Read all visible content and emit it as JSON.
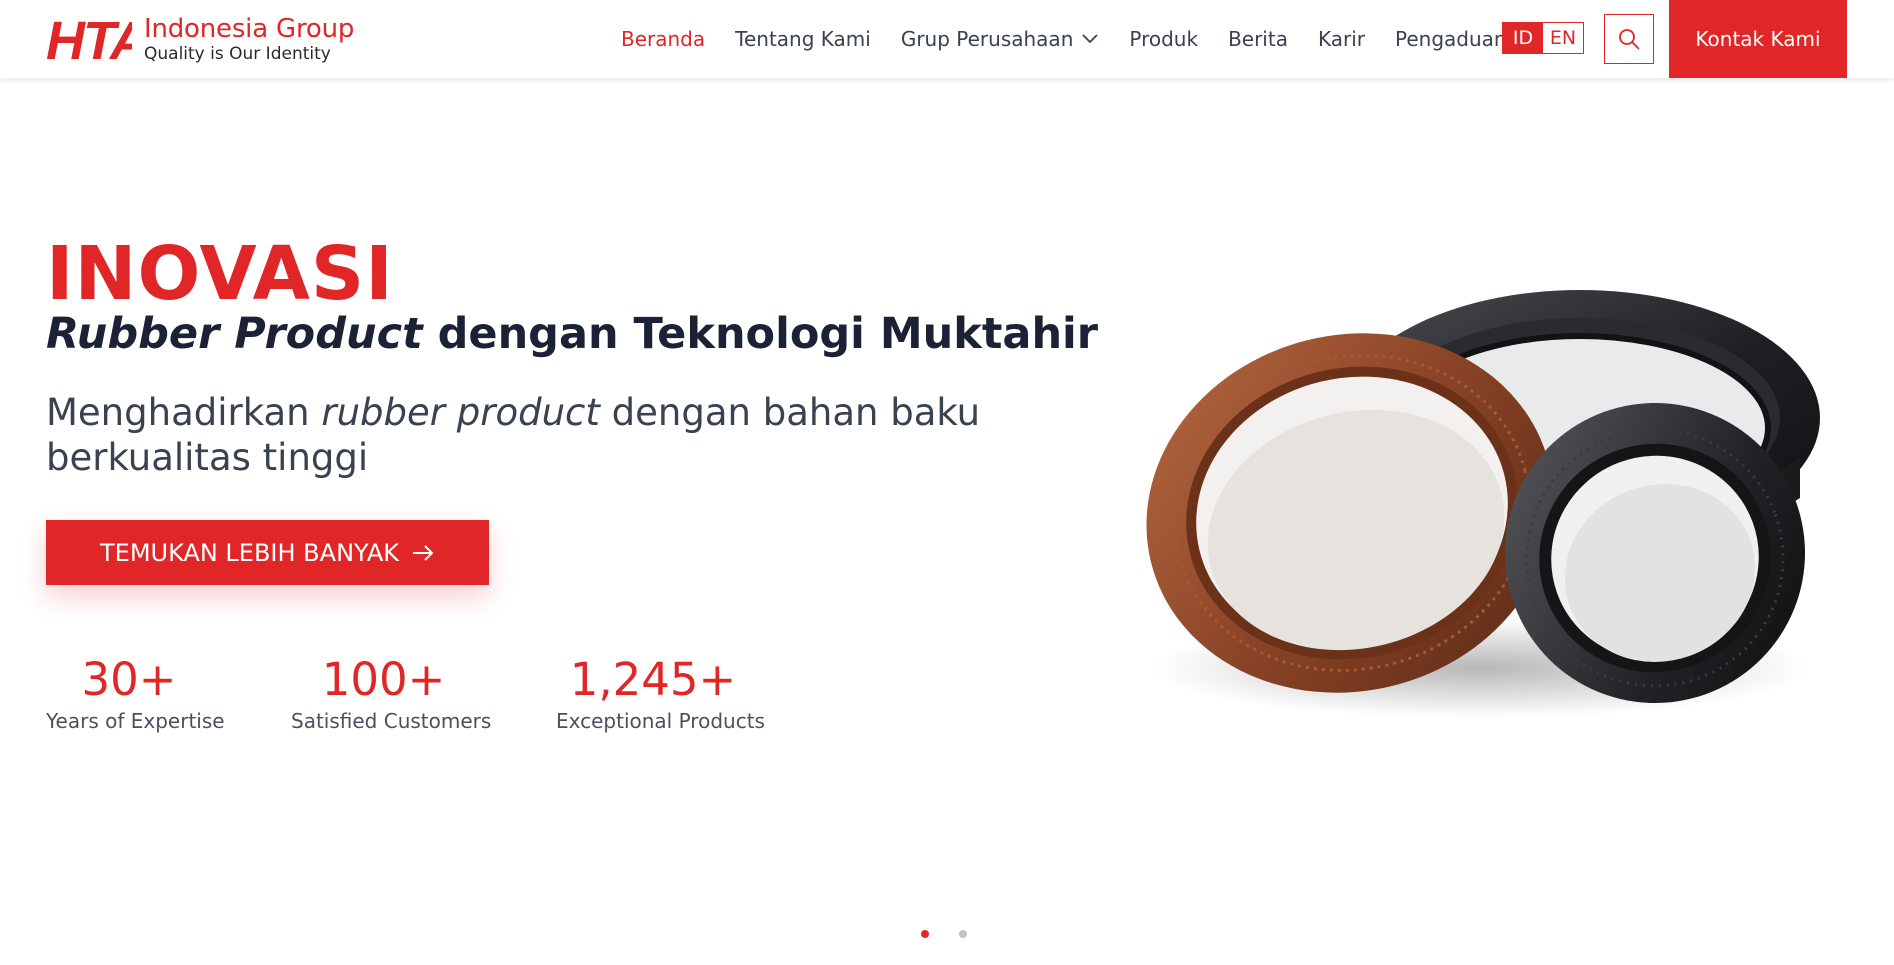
{
  "brand": {
    "mark": "HTA",
    "name": "Indonesia Group",
    "tagline": "Quality is Our Identity",
    "color": "#e12627"
  },
  "nav": {
    "items": [
      {
        "label": "Beranda",
        "active": true
      },
      {
        "label": "Tentang Kami"
      },
      {
        "label": "Grup Perusahaan",
        "icon": "chevron-down-icon"
      },
      {
        "label": "Produk"
      },
      {
        "label": "Berita"
      },
      {
        "label": "Karir"
      },
      {
        "label": "Pengaduan"
      }
    ]
  },
  "language": {
    "options": [
      "ID",
      "EN"
    ],
    "selected": "ID"
  },
  "search": {
    "icon": "search-icon"
  },
  "contact": {
    "label": "Kontak Kami"
  },
  "hero": {
    "title": "INOVASI",
    "subtitle_italic": "Rubber Product",
    "subtitle_rest": " dengan Teknologi Muktahir",
    "desc_part1": "Menghadirkan ",
    "desc_italic": "rubber product",
    "desc_part2": " dengan bahan baku berkualitas tinggi",
    "cta_label": "TEMUKAN LEBIH BANYAK",
    "cta_icon": "arrow-right-icon",
    "image": "oil-seal-rings-image"
  },
  "stats": [
    {
      "value": "30+",
      "label": "Years of Expertise"
    },
    {
      "value": "100+",
      "label": "Satisfied Customers"
    },
    {
      "value": "1,245+",
      "label": "Exceptional Products"
    }
  ],
  "carousel": {
    "slides": 2,
    "active": 1
  }
}
